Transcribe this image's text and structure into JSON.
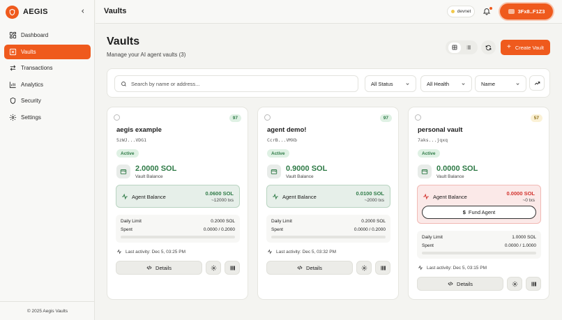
{
  "brand": {
    "name": "AEGIS"
  },
  "sidebar": {
    "items": [
      {
        "label": "Dashboard",
        "icon": "grid-icon"
      },
      {
        "label": "Vaults",
        "icon": "vault-icon",
        "active": true
      },
      {
        "label": "Transactions",
        "icon": "arrows-icon"
      },
      {
        "label": "Analytics",
        "icon": "chart-icon"
      },
      {
        "label": "Security",
        "icon": "shield-icon"
      },
      {
        "label": "Settings",
        "icon": "gear-icon"
      }
    ],
    "footer": "© 2025 Aegis Vaults"
  },
  "topbar": {
    "title": "Vaults",
    "network": "devnet",
    "wallet": "3Fx8..F1Z3"
  },
  "header": {
    "title": "Vaults",
    "subtitle": "Manage your AI agent vaults (3)",
    "create_label": "Create Vault"
  },
  "filters": {
    "search_placeholder": "Search by name or address...",
    "status": "All Status",
    "health": "All Health",
    "sort": "Name"
  },
  "colors": {
    "accent": "#ef5a1d",
    "success": "#2e7a46",
    "danger": "#d2322d"
  },
  "vaults": [
    {
      "score": "97",
      "name": "aegis example",
      "address": "5zWJ...VDG1",
      "status": "Active",
      "balance": "2.0000 SOL",
      "balance_label": "Vault Balance",
      "agent_label": "Agent Balance",
      "agent_balance": "0.0600 SOL",
      "agent_txs": "~12000 txs",
      "daily_limit_label": "Daily Limit",
      "daily_limit": "0.2000 SOL",
      "spent_label": "Spent",
      "spent": "0.0000 / 0.2000",
      "spent_fraction": 0,
      "last_activity": "Last activity: Dec 5, 03:25 PM",
      "details_label": "Details"
    },
    {
      "score": "97",
      "name": "agent demo!",
      "address": "CcrB...VMXb",
      "status": "Active",
      "balance": "0.9000 SOL",
      "balance_label": "Vault Balance",
      "agent_label": "Agent Balance",
      "agent_balance": "0.0100 SOL",
      "agent_txs": "~2000 txs",
      "daily_limit_label": "Daily Limit",
      "daily_limit": "0.2000 SOL",
      "spent_label": "Spent",
      "spent": "0.0000 / 0.2000",
      "spent_fraction": 0,
      "last_activity": "Last activity: Dec 5, 03:32 PM",
      "details_label": "Details"
    },
    {
      "score": "57",
      "name": "personal vault",
      "address": "7aks...jqxq",
      "status": "Active",
      "balance": "0.0000 SOL",
      "balance_label": "Vault Balance",
      "agent_label": "Agent Balance",
      "agent_balance": "0.0000 SOL",
      "agent_txs": "~0 txs",
      "fund_label": "Fund Agent",
      "daily_limit_label": "Daily Limit",
      "daily_limit": "1.0000 SOL",
      "spent_label": "Spent",
      "spent": "0.0000 / 1.0000",
      "spent_fraction": 0,
      "last_activity": "Last activity: Dec 5, 03:15 PM",
      "details_label": "Details"
    }
  ]
}
